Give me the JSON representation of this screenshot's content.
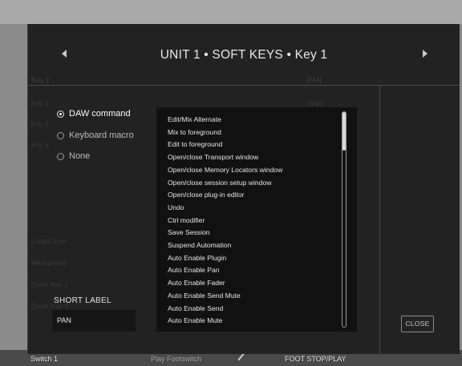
{
  "modal": {
    "title": "UNIT 1 • SOFT KEYS • Key 1",
    "nav_prev_icon": "chevron-left-icon",
    "nav_next_icon": "chevron-right-icon",
    "close_label": "CLOSE"
  },
  "options": {
    "selected": "DAW command",
    "items": [
      "DAW command",
      "Keyboard macro",
      "None"
    ]
  },
  "commands": [
    "Edit/Mix Alternate",
    "Mix to foreground",
    "Edit to foreground",
    "Open/close Transport window",
    "Open/close Memory Locators window",
    "Open/close session setup window",
    "Open/close plug-in editor",
    "Undo",
    "Ctrl modifier",
    "Save Session",
    "Suspend Automation",
    "Auto Enable Plugin",
    "Auto Enable Pan",
    "Auto Enable Fader",
    "Auto Enable Send Mute",
    "Auto Enable Send",
    "Auto Enable Mute"
  ],
  "short_label": {
    "title": "SHORT LABEL",
    "value": "PAN"
  },
  "ghost": {
    "header_key1": "Key 1",
    "header_pan": "PAN",
    "rows": [
      "Key 2",
      "Key 3",
      "Key 4"
    ],
    "row_pan": "PAN",
    "loop": "Loop/Cycle",
    "microphone": "Microphone",
    "quick_key": "Quick Key 1",
    "quick_key2": "Quick Key 2"
  },
  "background": {
    "switch_label": "Switch 1",
    "footswitch_label": "Play Footswitch",
    "foot_action": "FOOT STOP/PLAY"
  }
}
